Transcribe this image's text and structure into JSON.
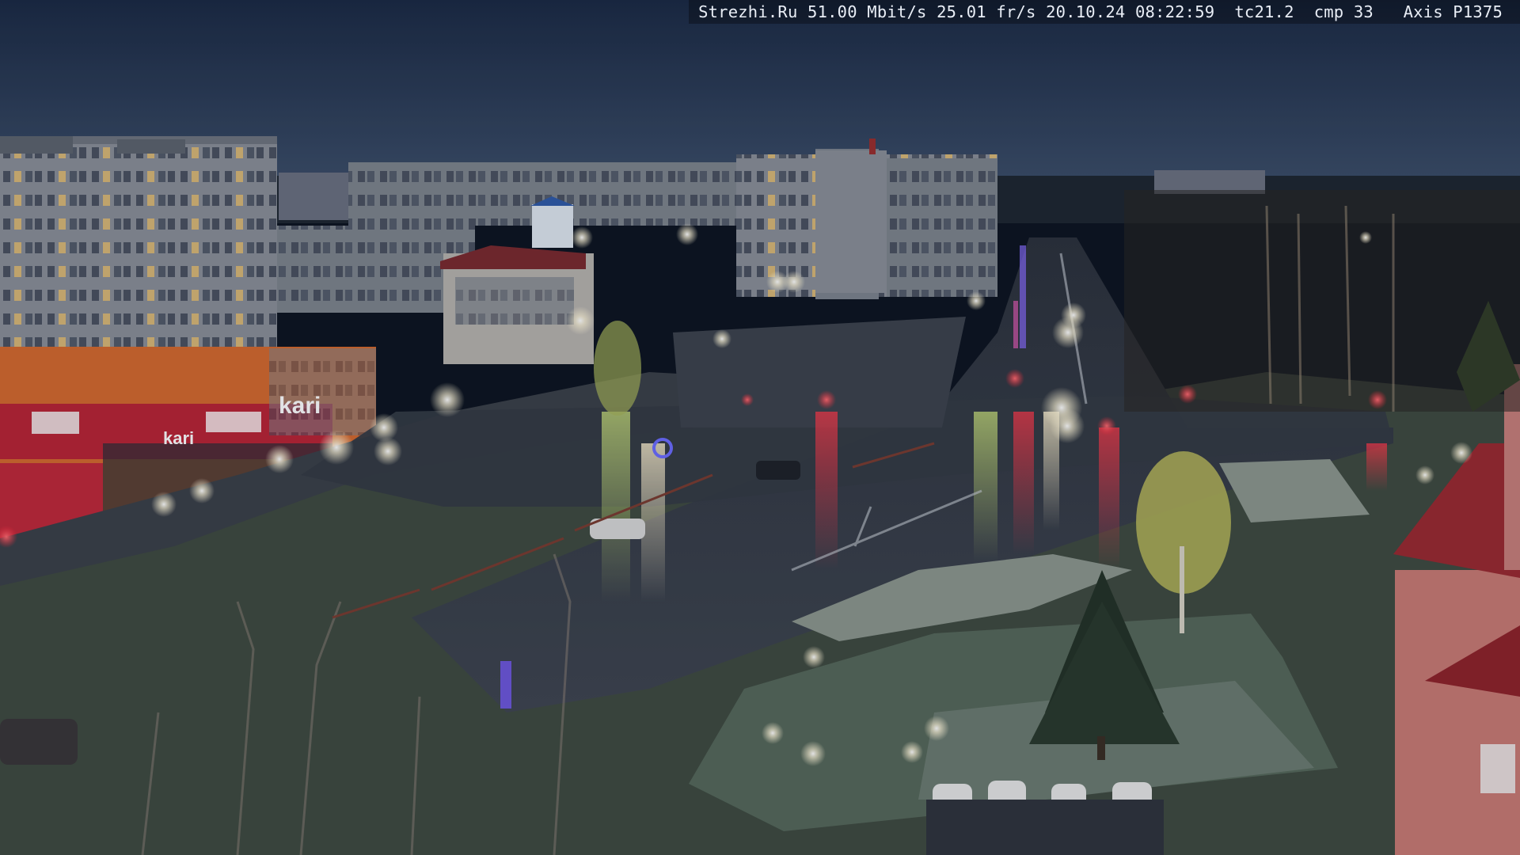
{
  "camera": {
    "overlay_text": "Strezhi.Ru 51.00 Mbit/s 25.01 fr/s 20.10.24 08:22:59  tc21.2  cmp 33   Axis P1375"
  },
  "scene": {
    "description_tags": [
      "dusk-cityscape",
      "wet-road-intersection",
      "apartment-blocks",
      "street-lamps",
      "traffic-lights",
      "parked-cars",
      "birch-trees"
    ],
    "storefront_signs": [
      "kari",
      "kari"
    ],
    "colors": {
      "sky_top": "#1b2a44",
      "sky_horizon": "#3b4d68",
      "road": "#3a3f48",
      "road_wet_highlight": "#6a7488",
      "building_panel": "#8a8f98",
      "storefront_red": "#c0283a",
      "storefront_orange": "#d4692e",
      "lamp_glow": "#fff6d8",
      "traffic_red": "#ff2a3a",
      "grass": "#3e4a3a",
      "snow_patch": "#8c978e"
    }
  }
}
